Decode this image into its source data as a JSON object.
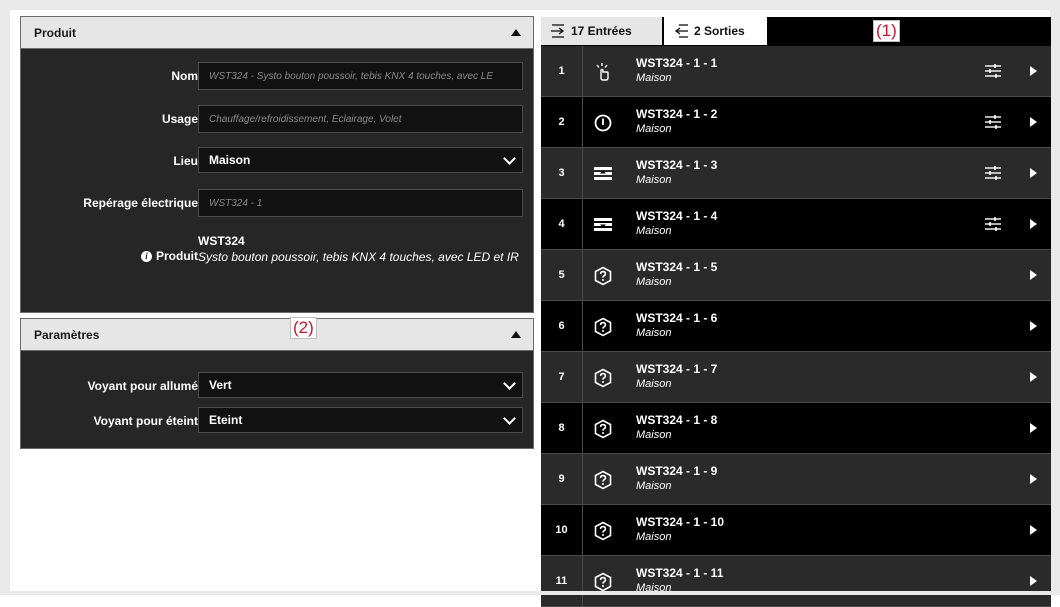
{
  "produit_panel": {
    "title": "Produit",
    "fields": {
      "nom_label": "Nom",
      "nom_placeholder": "WST324 - Systo bouton poussoir, tebis KNX 4 touches, avec LE",
      "usage_label": "Usage",
      "usage_placeholder": "Chauffage/refroidissement, Eclairage, Volet",
      "lieu_label": "Lieu",
      "lieu_value": "Maison",
      "reperage_label": "Repérage électrique",
      "reperage_placeholder": "WST324 - 1"
    },
    "product": {
      "label": "Produit",
      "name": "WST324",
      "description": "Systo bouton poussoir, tebis KNX 4 touches, avec LED et IR"
    }
  },
  "parametres_panel": {
    "title": "Paramètres",
    "voyant_allume_label": "Voyant pour allumé",
    "voyant_allume_value": "Vert",
    "voyant_eteint_label": "Voyant pour éteint",
    "voyant_eteint_value": "Eteint"
  },
  "annotations": {
    "one": "(1)",
    "two": "(2)"
  },
  "tabs": {
    "entrees": "17 Entrées",
    "sorties": "2 Sorties"
  },
  "channels": [
    {
      "num": "1",
      "title": "WST324 - 1 - 1",
      "location": "Maison",
      "icon": "touch-press-icon",
      "settings": true
    },
    {
      "num": "2",
      "title": "WST324 - 1 - 2",
      "location": "Maison",
      "icon": "power-toggle-icon",
      "settings": true
    },
    {
      "num": "3",
      "title": "WST324 - 1 - 3",
      "location": "Maison",
      "icon": "shutter-up-icon",
      "settings": true
    },
    {
      "num": "4",
      "title": "WST324 - 1 - 4",
      "location": "Maison",
      "icon": "shutter-down-icon",
      "settings": true
    },
    {
      "num": "5",
      "title": "WST324 - 1 - 5",
      "location": "Maison",
      "icon": "unknown-function-icon",
      "settings": false
    },
    {
      "num": "6",
      "title": "WST324 - 1 - 6",
      "location": "Maison",
      "icon": "unknown-function-icon",
      "settings": false
    },
    {
      "num": "7",
      "title": "WST324 - 1 - 7",
      "location": "Maison",
      "icon": "unknown-function-icon",
      "settings": false
    },
    {
      "num": "8",
      "title": "WST324 - 1 - 8",
      "location": "Maison",
      "icon": "unknown-function-icon",
      "settings": false
    },
    {
      "num": "9",
      "title": "WST324 - 1 - 9",
      "location": "Maison",
      "icon": "unknown-function-icon",
      "settings": false
    },
    {
      "num": "10",
      "title": "WST324 - 1 - 10",
      "location": "Maison",
      "icon": "unknown-function-icon",
      "settings": false
    },
    {
      "num": "11",
      "title": "WST324 - 1 - 11",
      "location": "Maison",
      "icon": "unknown-function-icon",
      "settings": false
    }
  ]
}
